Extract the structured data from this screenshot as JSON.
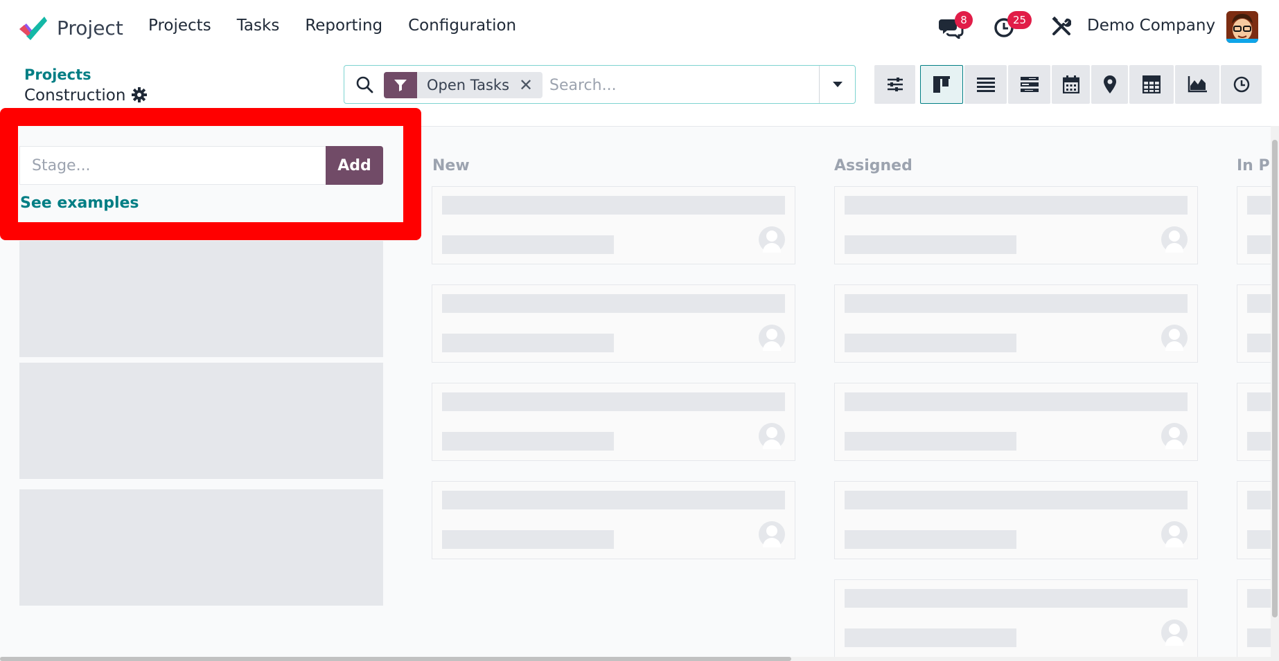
{
  "navbar": {
    "app_name": "Project",
    "menu": [
      "Projects",
      "Tasks",
      "Reporting",
      "Configuration"
    ],
    "messages_badge": "8",
    "activities_badge": "25",
    "company": "Demo Company"
  },
  "control_panel": {
    "breadcrumb_parent": "Projects",
    "breadcrumb_current": "Construction",
    "search": {
      "facet_label": "Open Tasks",
      "placeholder": "Search..."
    },
    "views": [
      "filters-icon",
      "kanban-icon",
      "list-icon",
      "gantt-icon",
      "calendar-icon",
      "map-icon",
      "pivot-icon",
      "graph-icon",
      "activity-icon"
    ],
    "active_view": "kanban-icon"
  },
  "quick_create_stage": {
    "placeholder": "Stage...",
    "add_label": "Add",
    "examples_link": "See examples"
  },
  "kanban": {
    "columns": [
      {
        "title": "New"
      },
      {
        "title": "Assigned"
      },
      {
        "title": "In Pr"
      }
    ]
  },
  "colors": {
    "brand": "#714b67",
    "link": "#017e84",
    "badge": "#e11d48",
    "highlight": "#ff0000"
  }
}
